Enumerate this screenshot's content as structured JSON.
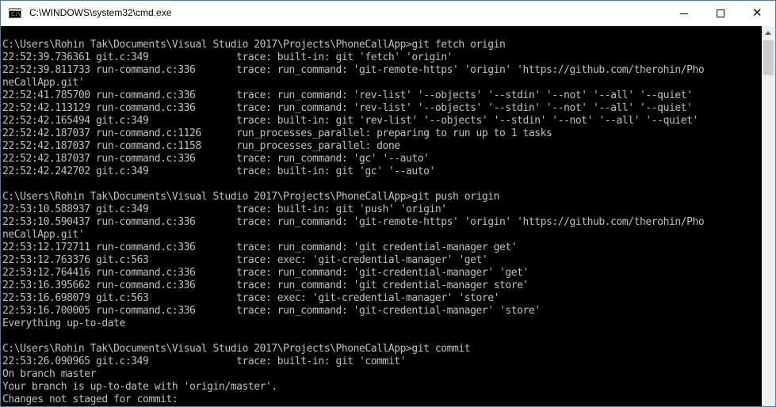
{
  "window": {
    "title": "C:\\WINDOWS\\system32\\cmd.exe",
    "icon_label": "C:\\_"
  },
  "controls": {
    "minimize_icon": "minimize-icon",
    "maximize_icon": "maximize-icon",
    "close_glyph": "✕"
  },
  "console": {
    "lines": [
      "C:\\Users\\Rohin Tak\\Documents\\Visual Studio 2017\\Projects\\PhoneCallApp>git fetch origin",
      "22:52:39.736361 git.c:349               trace: built-in: git 'fetch' 'origin'",
      "22:52:39.811733 run-command.c:336       trace: run_command: 'git-remote-https' 'origin' 'https://github.com/therohin/Pho",
      "neCallApp.git'",
      "22:52:41.785700 run-command.c:336       trace: run_command: 'rev-list' '--objects' '--stdin' '--not' '--all' '--quiet'",
      "22:52:42.113129 run-command.c:336       trace: run_command: 'rev-list' '--objects' '--stdin' '--not' '--all' '--quiet'",
      "22:52:42.165494 git.c:349               trace: built-in: git 'rev-list' '--objects' '--stdin' '--not' '--all' '--quiet'",
      "22:52:42.187037 run-command.c:1126      run_processes_parallel: preparing to run up to 1 tasks",
      "22:52:42.187037 run-command.c:1158      run_processes_parallel: done",
      "22:52:42.187037 run-command.c:336       trace: run_command: 'gc' '--auto'",
      "22:52:42.242702 git.c:349               trace: built-in: git 'gc' '--auto'",
      "",
      "C:\\Users\\Rohin Tak\\Documents\\Visual Studio 2017\\Projects\\PhoneCallApp>git push origin",
      "22:53:10.588937 git.c:349               trace: built-in: git 'push' 'origin'",
      "22:53:10.590437 run-command.c:336       trace: run_command: 'git-remote-https' 'origin' 'https://github.com/therohin/Pho",
      "neCallApp.git'",
      "22:53:12.172711 run-command.c:336       trace: run_command: 'git credential-manager get'",
      "22:53:12.763376 git.c:563               trace: exec: 'git-credential-manager' 'get'",
      "22:53:12.764416 run-command.c:336       trace: run_command: 'git-credential-manager' 'get'",
      "22:53:16.395662 run-command.c:336       trace: run_command: 'git credential-manager store'",
      "22:53:16.698079 git.c:563               trace: exec: 'git-credential-manager' 'store'",
      "22:53:16.700005 run-command.c:336       trace: run_command: 'git-credential-manager' 'store'",
      "Everything up-to-date",
      "",
      "C:\\Users\\Rohin Tak\\Documents\\Visual Studio 2017\\Projects\\PhoneCallApp>git commit",
      "22:53:26.090965 git.c:349               trace: built-in: git 'commit'",
      "On branch master",
      "Your branch is up-to-date with 'origin/master'.",
      "Changes not staged for commit:"
    ]
  },
  "scrollbar": {
    "up_icon": "scroll-up-arrow-icon"
  },
  "colors": {
    "console_background": "#000000",
    "console_text": "#c0c0c0",
    "titlebar_background": "#ffffff",
    "window_border": "#3c7fb1"
  }
}
